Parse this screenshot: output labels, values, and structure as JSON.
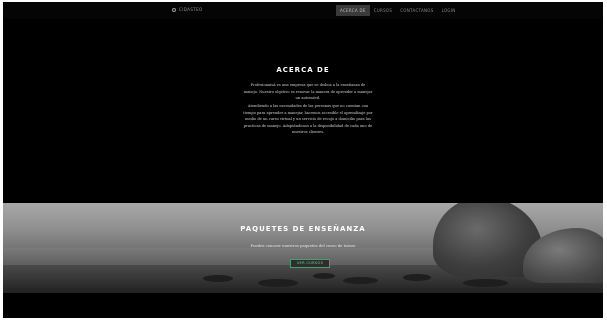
{
  "nav": {
    "brand": "Cidasteo",
    "links": [
      "Acerca de",
      "Cursos",
      "Contactanos",
      "Login"
    ]
  },
  "about": {
    "title": "ACERCA DE",
    "paragraph1": "ProfesionaisA es una empresa que se dedica a la enseñanza de manejo. Nuestro objetivo es renovar la manera de aprender a manejar un automóvil.",
    "paragraph2": "Atendiendo a las necesidades de las personas que no cuentan con tiempo para aprender a manejar, hacemos accesible el aprendizaje por medio de un curso virtual y un servicio de recojo a domicilio para las practicas de manejo. Adaptándonos a la disponibilidad de cada uno de nuestros clientes."
  },
  "packages": {
    "title": "PAQUETES DE ENSEÑANZA",
    "subtitle": "Puedes conocer nuestros paquetes del curso de tutoro",
    "button": "Ver cursos"
  },
  "colors": {
    "accent": "#4a9e6a",
    "background": "#000000"
  }
}
